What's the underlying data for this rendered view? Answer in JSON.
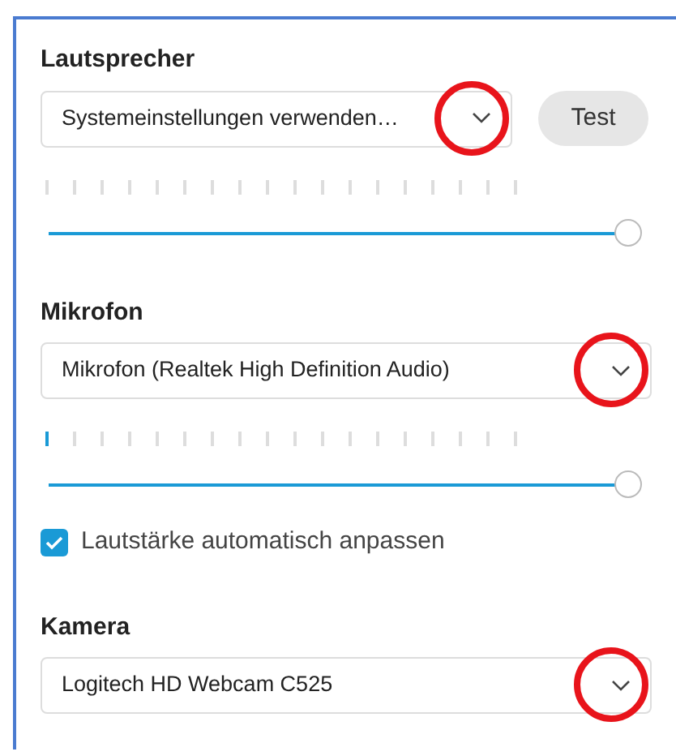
{
  "sections": [
    {
      "title": "Lautsprecher",
      "device": {
        "value": "Systemeinstellungen verwenden…",
        "highlighted": true
      },
      "button": "Test",
      "meter": {
        "segments": [
          {
            "lit": false
          },
          {
            "lit": false
          },
          {
            "lit": false
          },
          {
            "lit": false
          },
          {
            "lit": false
          },
          {
            "lit": false
          },
          {
            "lit": false
          },
          {
            "lit": false
          },
          {
            "lit": false
          },
          {
            "lit": false
          },
          {
            "lit": false
          },
          {
            "lit": false
          },
          {
            "lit": false
          },
          {
            "lit": false
          },
          {
            "lit": false
          },
          {
            "lit": false
          },
          {
            "lit": false
          },
          {
            "lit": false
          }
        ]
      },
      "volume": {
        "level": 1
      }
    },
    {
      "title": "Mikrofon",
      "device": {
        "value": "Mikrofon (Realtek High Definition Audio)",
        "highlighted": true
      },
      "meter": {
        "segments": [
          {
            "lit": true
          },
          {
            "lit": false
          },
          {
            "lit": false
          },
          {
            "lit": false
          },
          {
            "lit": false
          },
          {
            "lit": false
          },
          {
            "lit": false
          },
          {
            "lit": false
          },
          {
            "lit": false
          },
          {
            "lit": false
          },
          {
            "lit": false
          },
          {
            "lit": false
          },
          {
            "lit": false
          },
          {
            "lit": false
          },
          {
            "lit": false
          },
          {
            "lit": false
          },
          {
            "lit": false
          },
          {
            "lit": false
          }
        ]
      },
      "volume": {
        "level": 1
      },
      "auto_adjust": {
        "label": "Lautstärke automatisch anpassen",
        "checked": true
      }
    },
    {
      "title": "Kamera",
      "device": {
        "value": "Logitech HD Webcam C525",
        "highlighted": true
      }
    }
  ]
}
